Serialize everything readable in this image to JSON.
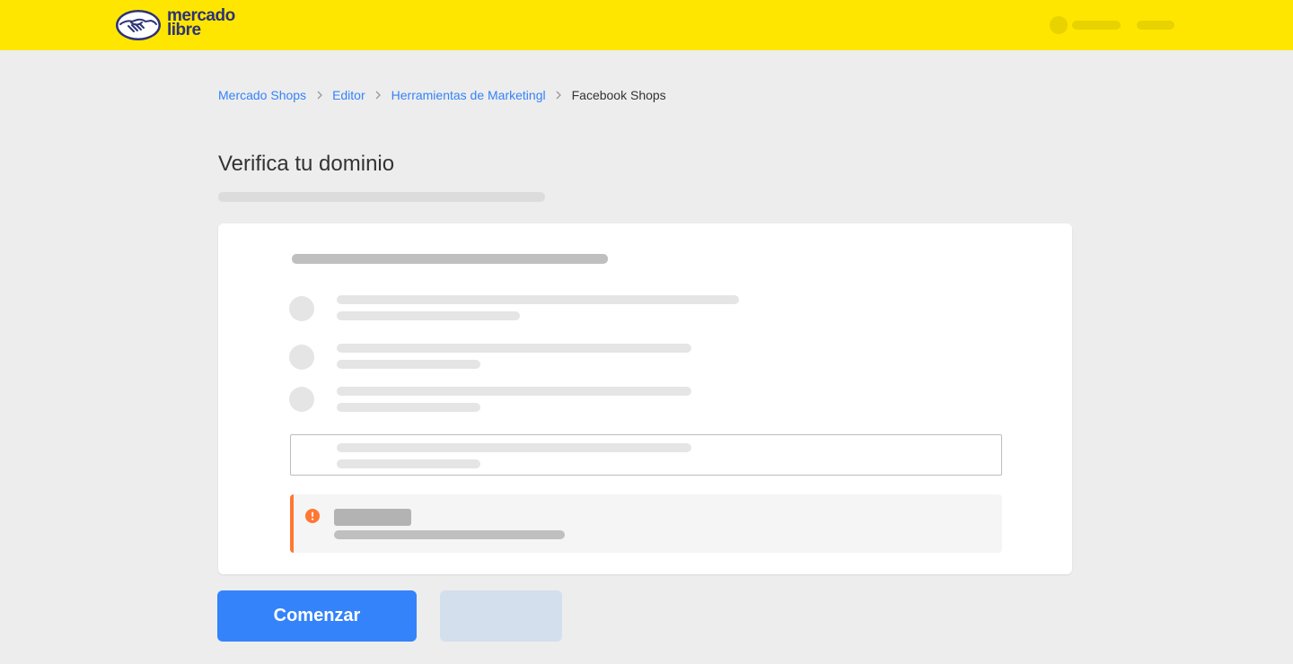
{
  "header": {
    "logo_line1": "mercado",
    "logo_line2": "libre",
    "brand_color": "#ffe600",
    "logo_text_color": "#2d3277"
  },
  "breadcrumb": {
    "items": [
      {
        "label": "Mercado Shops",
        "link": true
      },
      {
        "label": "Editor",
        "link": true
      },
      {
        "label": "Herramientas de Marketingl",
        "link": true
      },
      {
        "label": "Facebook Shops",
        "link": false
      }
    ],
    "separator_icon": "chevron-right-icon",
    "link_color": "#3483fa"
  },
  "page": {
    "title": "Verifica tu dominio"
  },
  "notice": {
    "icon": "warning-icon",
    "accent_color": "#ff7733"
  },
  "actions": {
    "primary_label": "Comenzar",
    "primary_color": "#3483fa",
    "secondary_color": "#d3dfec"
  }
}
